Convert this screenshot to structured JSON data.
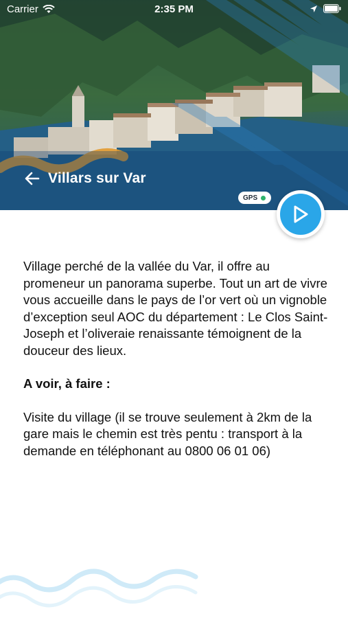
{
  "status_bar": {
    "carrier": "Carrier",
    "time": "2:35 PM"
  },
  "header": {
    "title": "Villars sur Var",
    "gps_label": "GPS",
    "gps_status_color": "#2fb36b"
  },
  "content": {
    "description": "Village perché de la vallée du Var,  il offre au promeneur un panorama superbe. Tout un art de vivre vous accueille dans le pays de l’or vert où un vignoble d’exception seul AOC du département : Le Clos Saint-Joseph et l’oliveraie renaissante témoignent de la douceur des lieux.",
    "section_heading": "A voir, à faire :",
    "section_text": "Visite du village (il se trouve seulement à 2km de la gare mais le chemin est très pentu : transport à la demande en téléphonant au 0800 06 01 06)"
  },
  "icons": {
    "wifi": "wifi-icon",
    "location": "location-arrow-icon",
    "battery": "battery-icon",
    "back": "back-arrow-icon",
    "play": "play-icon"
  },
  "colors": {
    "accent_blue": "#2aa6e8",
    "hero_bottom": "#1c5c93",
    "orange_wave": "#e39a2f",
    "light_wave": "#cfeaf8"
  }
}
